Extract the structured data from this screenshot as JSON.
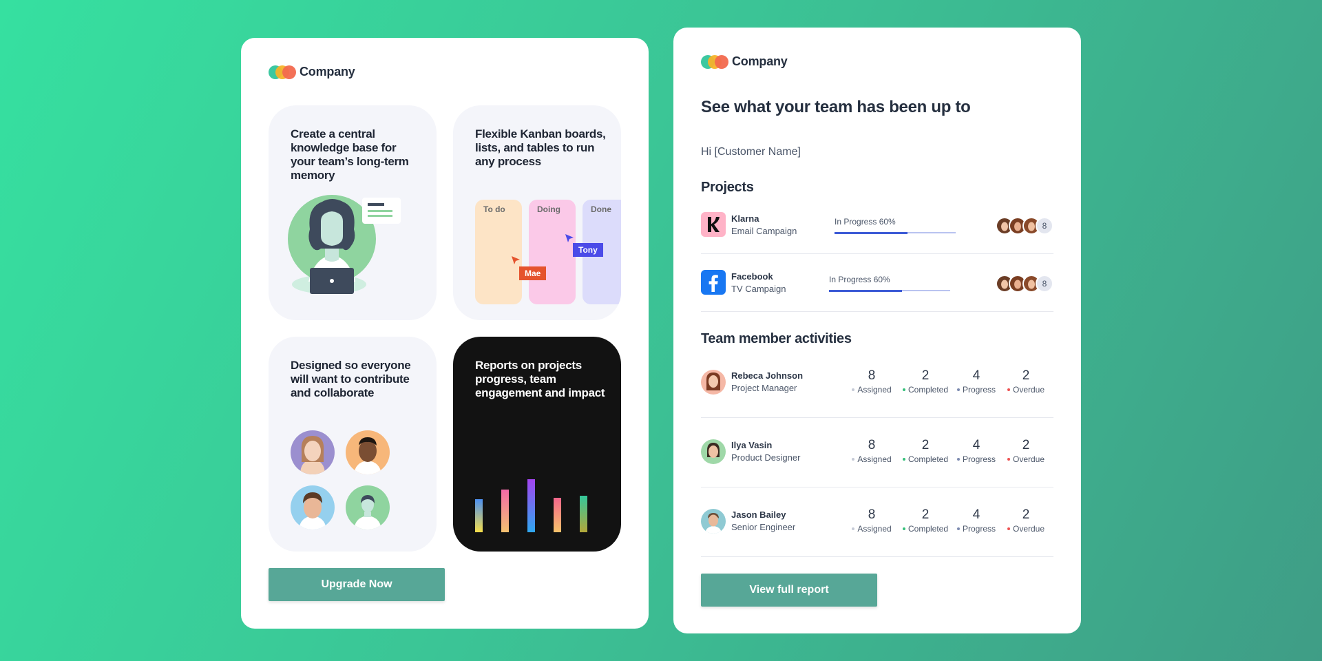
{
  "left_email": {
    "logo_text": "Company",
    "tiles": [
      {
        "title": "Create a central knowledge base for your team’s long-term memory"
      },
      {
        "title": "Flexible Kanban boards, lists, and tables to run any process"
      },
      {
        "title": "Designed so everyone will want to contribute and collaborate"
      },
      {
        "title": "Reports on projects progress, team engagement and impact"
      }
    ],
    "kanban": {
      "columns": [
        {
          "label": "To do",
          "color": "#fde4c6"
        },
        {
          "label": "Doing",
          "color": "#fbc9e8"
        },
        {
          "label": "Done",
          "color": "#dcdcfb"
        }
      ],
      "cursors": [
        {
          "label": "Mae",
          "color": "#e5532d"
        },
        {
          "label": "Tony",
          "color": "#4b4be8"
        }
      ]
    },
    "cta_label": "Upgrade Now"
  },
  "right_email": {
    "logo_text": "Company",
    "headline": "See what your team has been up to",
    "greeting": "Hi [Customer Name]",
    "projects_title": "Projects",
    "projects": [
      {
        "name": "Klarna",
        "subtitle": "Email Campaign",
        "status": "In Progress 60%",
        "progress": 0.6,
        "member_count": "8",
        "icon": "klarna-logo"
      },
      {
        "name": "Facebook",
        "subtitle": "TV Campaign",
        "status": "In Progress 60%",
        "progress": 0.6,
        "member_count": "8",
        "icon": "facebook-logo"
      }
    ],
    "activities_title": "Team member activities",
    "stat_labels": [
      "Assigned",
      "Completed",
      "Progress",
      "Overdue"
    ],
    "stat_colors": [
      "#c5cad6",
      "#36c07a",
      "#7d8bb0",
      "#ee5151"
    ],
    "members": [
      {
        "name": "Rebeca Johnson",
        "role": "Project Manager",
        "stats": [
          "8",
          "2",
          "4",
          "2"
        ]
      },
      {
        "name": "Ilya Vasin",
        "role": "Product Designer",
        "stats": [
          "8",
          "2",
          "4",
          "2"
        ]
      },
      {
        "name": "Jason Bailey",
        "role": "Senior Engineer",
        "stats": [
          "8",
          "2",
          "4",
          "2"
        ]
      }
    ],
    "cta_label": "View full report"
  }
}
